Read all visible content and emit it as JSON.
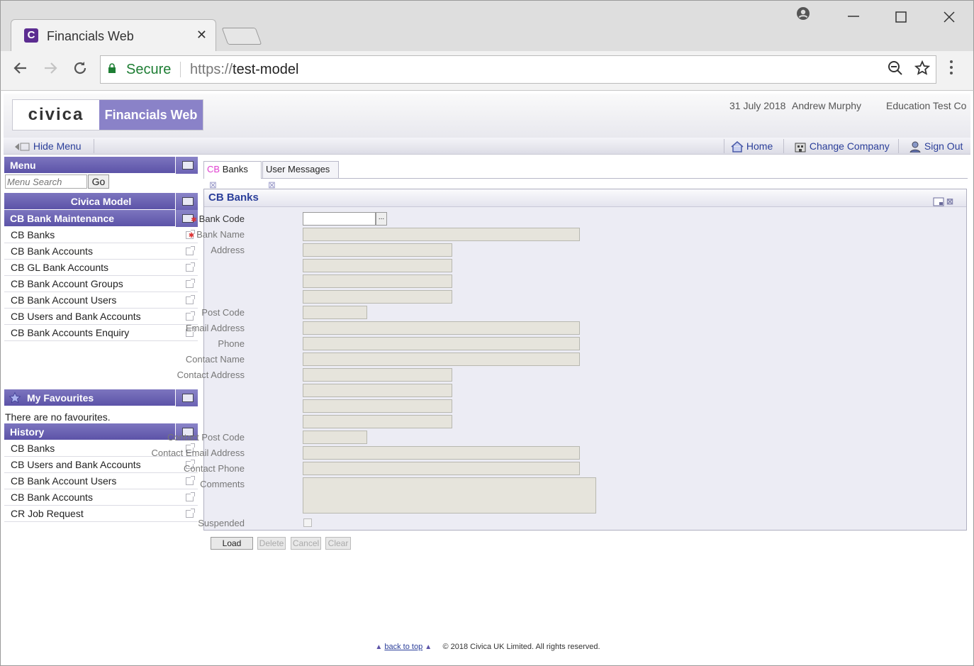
{
  "browser": {
    "tab_title": "Financials Web",
    "tab_favicon": "C",
    "tab_close": "✕",
    "secure_label": "Secure",
    "url_scheme": "https://",
    "url_host": "test-model"
  },
  "header": {
    "logo_text": "civica",
    "product_name": "Financials Web",
    "date": "31 July 2018",
    "user": "Andrew Murphy",
    "company": "Education Test Co"
  },
  "subbar": {
    "hide_menu": "Hide Menu",
    "home": "Home",
    "change_company": "Change Company",
    "sign_out": "Sign Out"
  },
  "sidebar": {
    "menu_title": "Menu",
    "search_placeholder": "Menu Search",
    "go_label": "Go",
    "model_title": "Civica Model",
    "section_title": "CB Bank Maintenance",
    "menu_items": [
      "CB Banks",
      "CB Bank Accounts",
      "CB GL Bank Accounts",
      "CB Bank Account Groups",
      "CB Bank Account Users",
      "CB Users and Bank Accounts",
      "CB Bank Accounts Enquiry"
    ],
    "favourites_title": "My Favourites",
    "no_favourites": "There are no favourites.",
    "history_title": "History",
    "history_items": [
      "CB Banks",
      "CB Users and Bank Accounts",
      "CB Bank Account Users",
      "CB Bank Accounts",
      "CR Job Request"
    ]
  },
  "tabs": {
    "active_prefix": "CB",
    "active_label": "Banks",
    "second_label": "User Messages",
    "close_glyph": "⊠"
  },
  "form": {
    "title": "CB Banks",
    "required_mark": "✱",
    "browse_label": "...",
    "labels": {
      "bank_code": "Bank Code",
      "bank_name": "Bank Name",
      "address": "Address",
      "post_code": "Post Code",
      "email": "Email Address",
      "phone": "Phone",
      "contact_name": "Contact Name",
      "contact_address": "Contact Address",
      "contact_post_code": "Contact Post Code",
      "contact_email": "Contact Email Address",
      "contact_phone": "Contact Phone",
      "comments": "Comments",
      "suspended": "Suspended"
    },
    "buttons": {
      "load": "Load",
      "delete": "Delete",
      "cancel": "Cancel",
      "clear": "Clear"
    }
  },
  "footer": {
    "back_to_top": "back to top",
    "copyright": "© 2018 Civica UK Limited. All rights reserved."
  }
}
